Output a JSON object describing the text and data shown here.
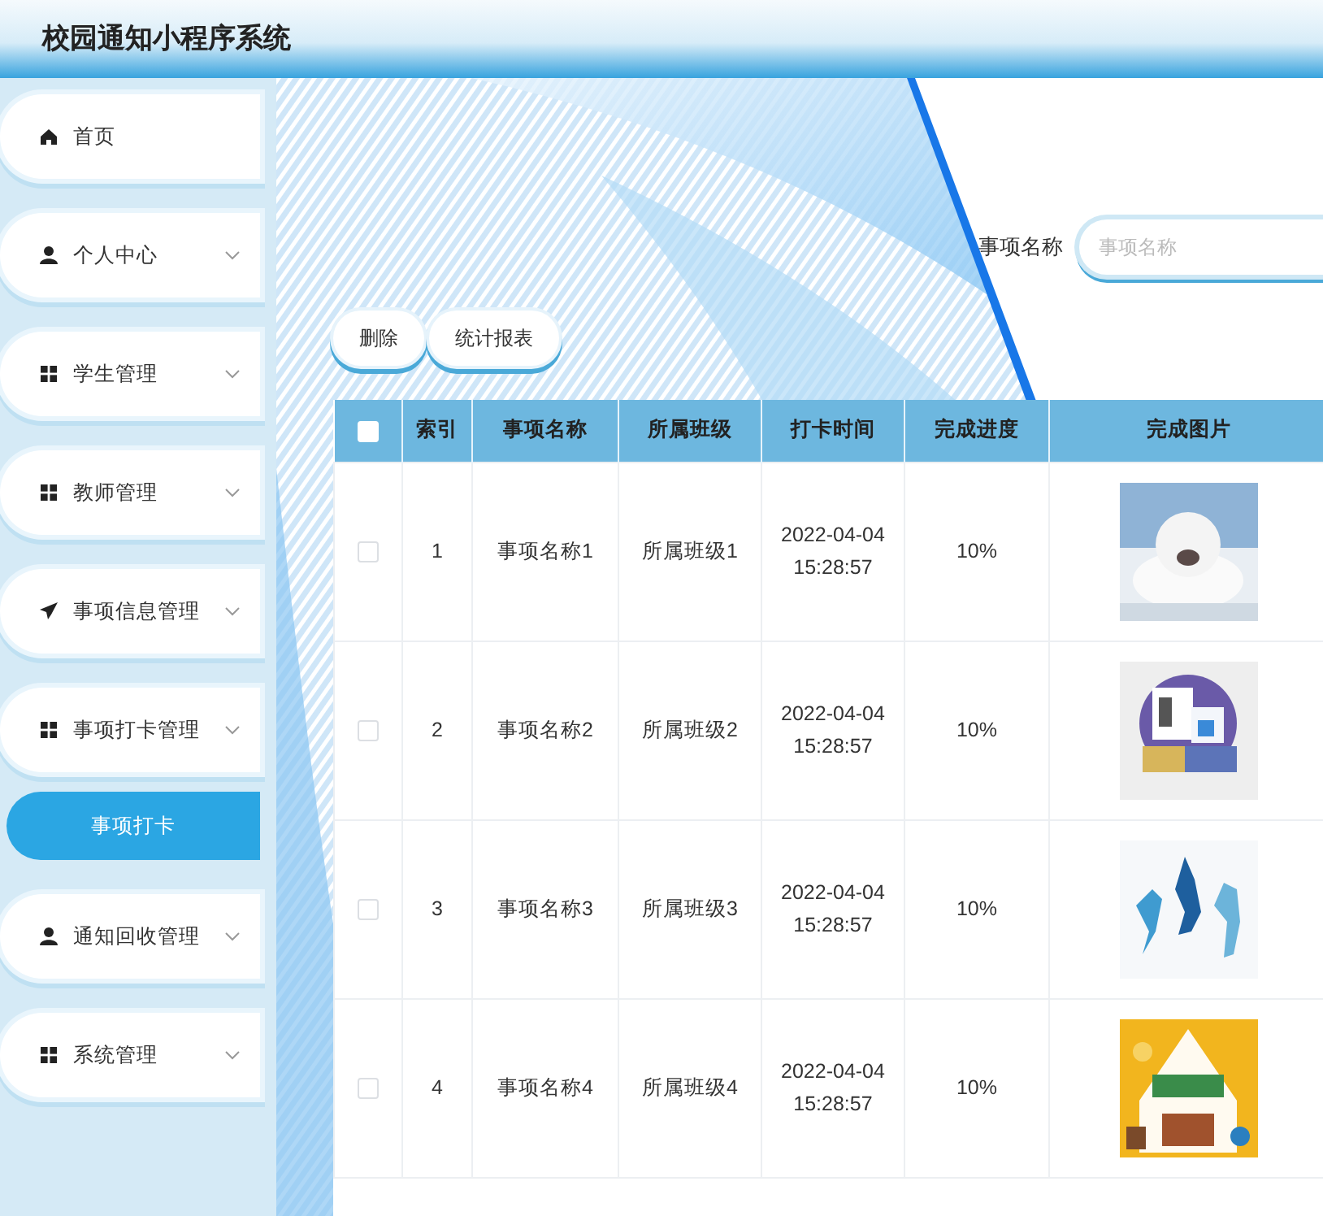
{
  "header": {
    "title": "校园通知小程序系统"
  },
  "sidebar": {
    "items": [
      {
        "label": "首页"
      },
      {
        "label": "个人中心",
        "has_submenu": true
      },
      {
        "label": "学生管理",
        "has_submenu": true
      },
      {
        "label": "教师管理",
        "has_submenu": true
      },
      {
        "label": "事项信息管理",
        "has_submenu": true
      },
      {
        "label": "事项打卡管理",
        "has_submenu": true,
        "expanded": true,
        "children": [
          {
            "label": "事项打卡",
            "selected": true
          }
        ]
      },
      {
        "label": "通知回收管理",
        "has_submenu": true
      },
      {
        "label": "系统管理",
        "has_submenu": true
      }
    ]
  },
  "search": {
    "label": "事项名称",
    "placeholder": "事项名称"
  },
  "buttons": [
    "删除",
    "统计报表"
  ],
  "table": {
    "select_all": {
      "checked": false
    },
    "columns": [
      "索引",
      "事项名称",
      "所属班级",
      "打卡时间",
      "完成进度",
      "完成图片"
    ],
    "rows": [
      {
        "checked": false,
        "index": "1",
        "name": "事项名称1",
        "class_name": "所属班级1",
        "time": "2022-04-04 15:28:57",
        "progress": "10%"
      },
      {
        "checked": false,
        "index": "2",
        "name": "事项名称2",
        "class_name": "所属班级2",
        "time": "2022-04-04 15:28:57",
        "progress": "10%"
      },
      {
        "checked": false,
        "index": "3",
        "name": "事项名称3",
        "class_name": "所属班级3",
        "time": "2022-04-04 15:28:57",
        "progress": "10%"
      },
      {
        "checked": false,
        "index": "4",
        "name": "事项名称4",
        "class_name": "所属班级4",
        "time": "2022-04-04 15:28:57",
        "progress": "10%"
      }
    ]
  }
}
